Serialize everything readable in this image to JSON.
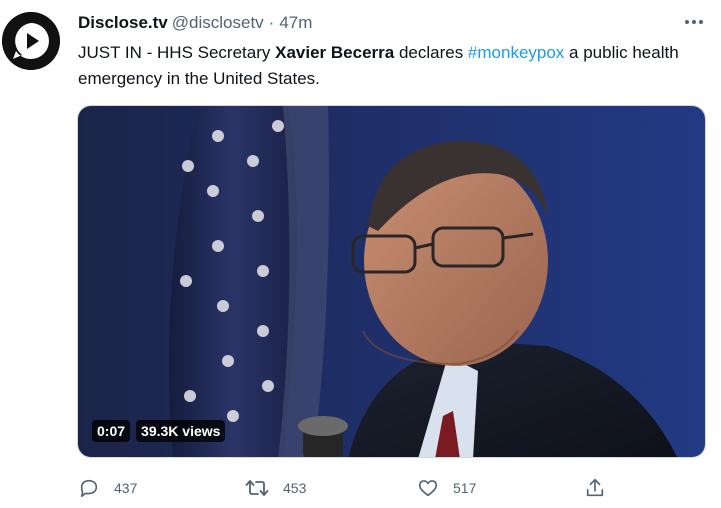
{
  "author": {
    "name": "Disclose.tv",
    "handle": "@disclosetv",
    "separator": "·",
    "time": "47m",
    "avatar_icon": "disclose-tv-play-logo-icon"
  },
  "tweet": {
    "text_before": "JUST IN - HHS Secretary ",
    "bold_name": "Xavier Becerra",
    "text_mid": " declares ",
    "hashtag": "#monkeypox",
    "text_after": " a public health emergency in the United States."
  },
  "media": {
    "type": "video",
    "duration": "0:07",
    "views": "39.3K views"
  },
  "actions": {
    "reply_icon": "reply-icon",
    "reply_count": "437",
    "retweet_icon": "retweet-icon",
    "retweet_count": "453",
    "like_icon": "heart-icon",
    "like_count": "517",
    "share_icon": "share-icon"
  },
  "colors": {
    "link": "#1d9bf0",
    "secondary_text": "#536471",
    "primary_text": "#0f1419"
  }
}
